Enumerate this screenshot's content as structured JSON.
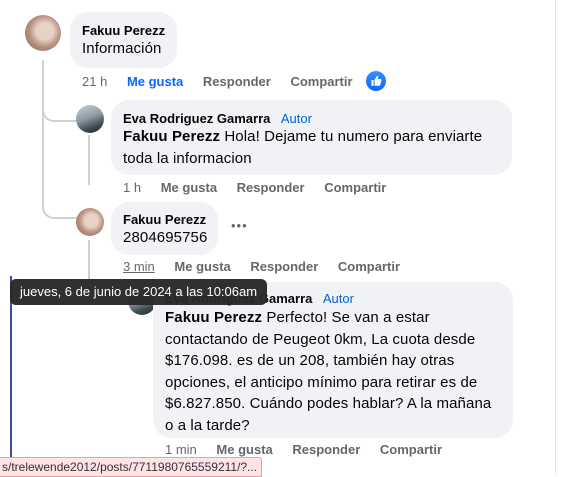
{
  "comments": [
    {
      "author": "Fakuu Perezz",
      "text": "Información",
      "actions": {
        "time": "21 h",
        "like": "Me gusta",
        "reply": "Responder",
        "share": "Compartir"
      },
      "reaction_icon": "thumbs-up-icon"
    },
    {
      "author": "Eva Rodriguez Gamarra",
      "badge": "Autor",
      "mention": "Fakuu Perezz",
      "text_lines": [
        " Hola! Dejame tu numero para enviarte",
        "toda la informacion"
      ],
      "actions": {
        "time": "1 h",
        "like": "Me gusta",
        "reply": "Responder",
        "share": "Compartir"
      }
    },
    {
      "author": "Fakuu Perezz",
      "text": "2804695756",
      "more": "•••",
      "actions": {
        "time": "3 min",
        "like": "Me gusta",
        "reply": "Responder",
        "share": "Compartir"
      }
    },
    {
      "author": "Eva Rodriguez Gamarra",
      "badge": "Autor",
      "mention": "Fakuu Perezz",
      "text_lines": [
        " Perfecto! Se van a estar",
        "contactando de Peugeot 0km, La cuota desde",
        "$176.098. es de un 208, también hay otras",
        "opciones, el anticipo mínimo para retirar es de",
        "$6.827.850. Cuándo podes hablar? A la mañana",
        "o a la tarde?"
      ],
      "actions": {
        "time": "1 min",
        "like": "Me gusta",
        "reply": "Responder",
        "share": "Compartir"
      }
    }
  ],
  "tooltip": "jueves, 6 de junio de 2024 a las 10:06am",
  "status_url": "s/trelewende2012/posts/7711980765559211/?...",
  "colors": {
    "accent": "#0866ff",
    "bubble": "#f0f2f5",
    "muted": "#65676b",
    "author": "#0064d1"
  }
}
